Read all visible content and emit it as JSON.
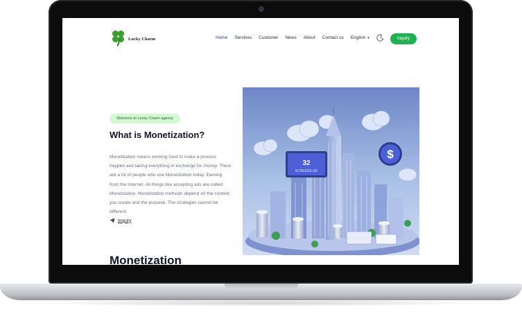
{
  "header": {
    "logo_text": "Lucky Charm",
    "nav": [
      "Home",
      "Services",
      "Customer",
      "News",
      "About",
      "Contact us"
    ],
    "language": "English",
    "inquiry_button": "Inquiry"
  },
  "hero": {
    "badge": "Welcome to Lucky Charm agency",
    "title": "What is Monetization?",
    "body": "Monetization means working hard to make a process happen and taking everything in exchange for money. There are a lot of people who use Monetization today. Earning from the Internet. All things like accepting ads are called Monetization. Monetization methods depend on the content you create and the purpose. The strategies cannot be different.",
    "link_label": "Inquiry"
  },
  "section": {
    "title": "Monetization"
  },
  "illustration": {
    "label_number": "32",
    "label_text": "SCREENS.AD",
    "coin_symbol": "$"
  },
  "colors": {
    "accent_green": "#1db254",
    "badge_bg": "#d5f7d3",
    "illustration_blue": "#4d5fd6"
  }
}
